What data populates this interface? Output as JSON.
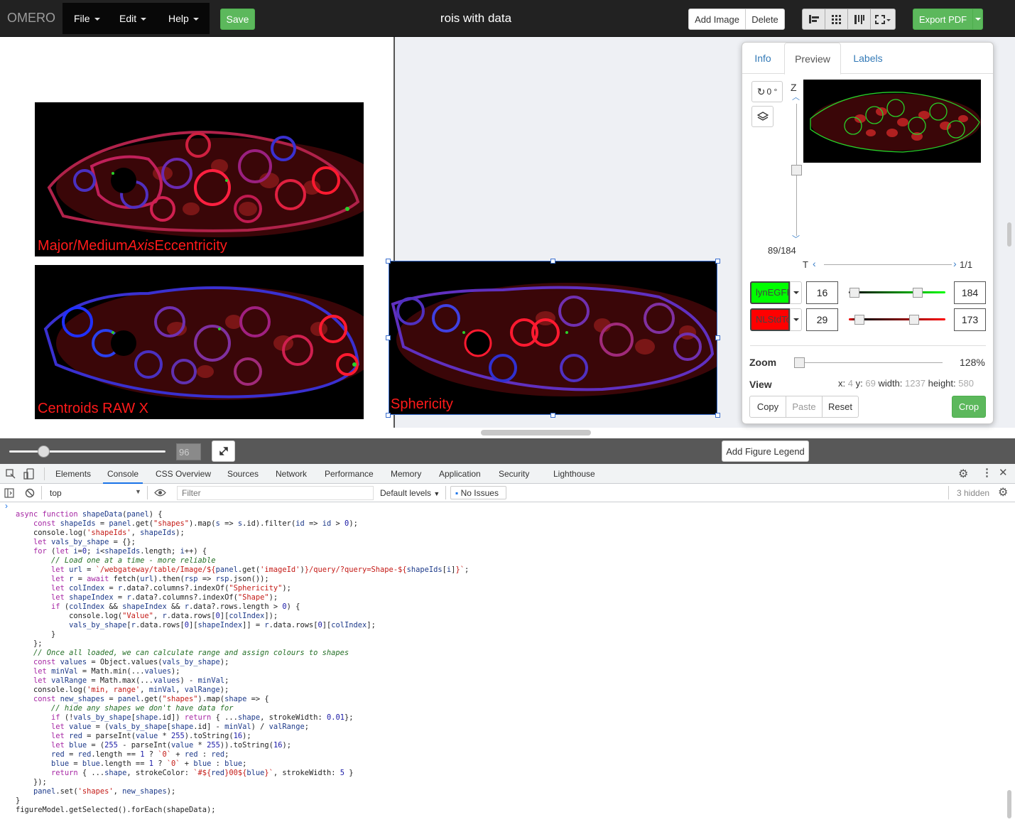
{
  "app": {
    "brand": "OMERO",
    "title": "rois with data"
  },
  "menu": {
    "file": "File",
    "edit": "Edit",
    "help": "Help",
    "save": "Save"
  },
  "toolbar": {
    "add_image": "Add Image",
    "delete": "Delete",
    "export_pdf": "Export PDF"
  },
  "panels": [
    {
      "label_parts": [
        "Major/Medium",
        "Axis",
        "Eccentricity"
      ]
    },
    {
      "label": "Centroids RAW X"
    },
    {
      "label": "Sphericity"
    }
  ],
  "right_panel": {
    "tabs": [
      "Info",
      "Preview",
      "Labels"
    ],
    "rotation": "0 °",
    "z_label": "Z",
    "z_value": "89/184",
    "t_label": "T",
    "t_value": "1/1",
    "channels": [
      {
        "name": "lynEGFP",
        "min": "16",
        "max": "184",
        "color": "#00ff00"
      },
      {
        "name": "NLStdTomato",
        "min": "29",
        "max": "173",
        "color": "#ff0000"
      }
    ],
    "zoom_label": "Zoom",
    "zoom_value": "128%",
    "view_label": "View",
    "view": {
      "x_label": "x:",
      "x": "4",
      "y_label": "y:",
      "y": "69",
      "w_label": "width:",
      "w": "1237",
      "h_label": "height:",
      "h": "580"
    },
    "copy": "Copy",
    "paste": "Paste",
    "reset": "Reset",
    "crop": "Crop"
  },
  "bottom": {
    "zoom_input": "96",
    "add_legend": "Add Figure Legend"
  },
  "devtools": {
    "tabs": [
      "Elements",
      "Console",
      "CSS Overview",
      "Sources",
      "Network",
      "Performance",
      "Memory",
      "Application",
      "Security",
      "Lighthouse"
    ],
    "context": "top",
    "filter_placeholder": "Filter",
    "levels": "Default levels",
    "issues": "No Issues",
    "hidden": "3 hidden"
  }
}
